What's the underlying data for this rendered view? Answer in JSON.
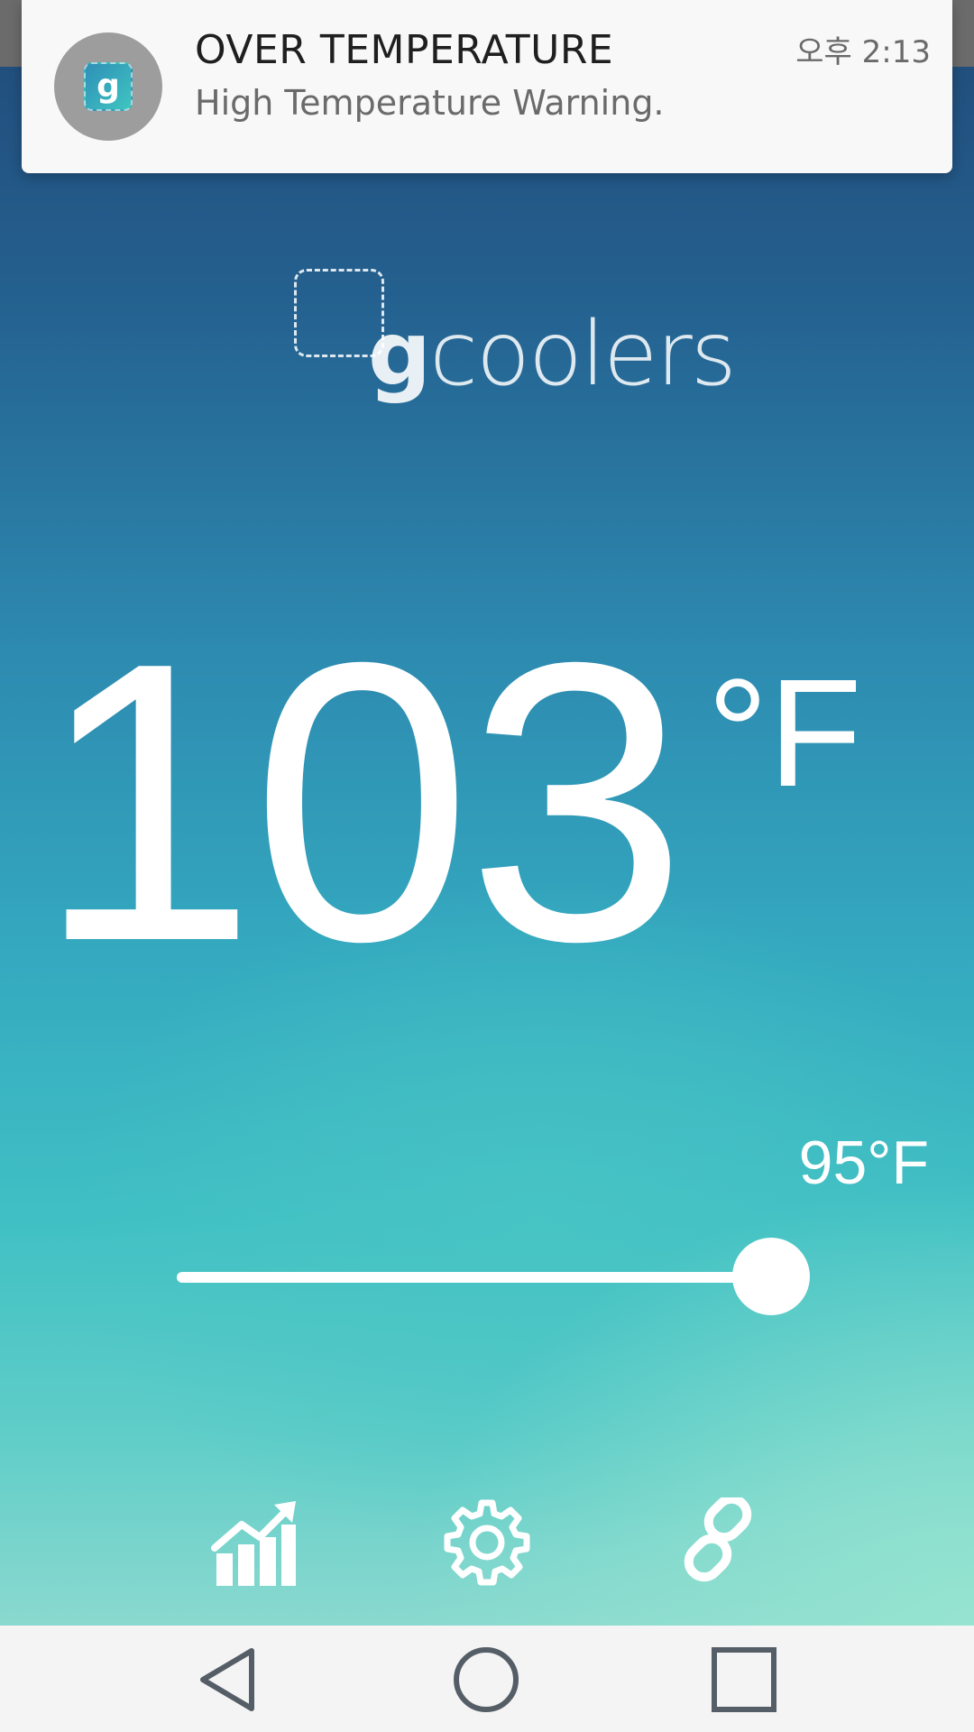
{
  "notification": {
    "app_icon_letter": "g",
    "title": "OVER TEMPERATURE",
    "body": "High Temperature Warning.",
    "time": "오후 2:13"
  },
  "logo": {
    "g": "g",
    "rest": "coolers"
  },
  "temperature": {
    "value": "103",
    "unit": "°F"
  },
  "setpoint": {
    "label": "95°F",
    "slider_position": 1.0
  },
  "toolbar": {
    "icons": [
      "chart-icon",
      "gear-icon",
      "link-icon"
    ]
  },
  "navbar": {
    "icons": [
      "back-icon",
      "home-icon",
      "recents-icon"
    ]
  },
  "colors": {
    "gradient_top": "#214a78",
    "gradient_mid": "#34a8bf",
    "gradient_bottom": "#8ad9cf",
    "nav_icon": "#555e66"
  }
}
